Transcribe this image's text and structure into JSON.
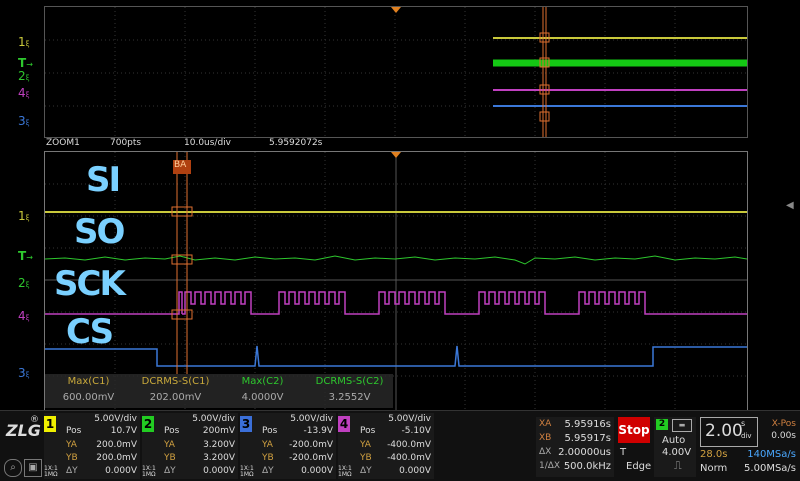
{
  "overview": {
    "channels": [
      {
        "label": "1",
        "sub": "ξ",
        "color": "#c9c93b"
      },
      {
        "label": "T",
        "sub": "",
        "color": "#2ec82e"
      },
      {
        "label": "2",
        "sub": "ξ",
        "color": "#2ec82e"
      },
      {
        "label": "4",
        "sub": "ξ",
        "color": "#c040c0"
      },
      {
        "label": "3",
        "sub": "ξ",
        "color": "#3b78d8"
      }
    ]
  },
  "zoombar": {
    "name": "ZOOM1",
    "pts": "700pts",
    "timebase": "10.0us/div",
    "time": "5.9592072s"
  },
  "zoom": {
    "cursor_tag": "BA",
    "annotations": [
      "SI",
      "SO",
      "SCK",
      "CS"
    ],
    "channels": [
      {
        "label": "1",
        "sub": "ξ",
        "color": "#c9c93b"
      },
      {
        "label": "T",
        "sub": "",
        "color": "#2ec82e"
      },
      {
        "label": "2",
        "sub": "ξ",
        "color": "#2ec82e"
      },
      {
        "label": "4",
        "sub": "ξ",
        "color": "#c040c0"
      },
      {
        "label": "3",
        "sub": "ξ",
        "color": "#3b78d8"
      }
    ]
  },
  "measurements": [
    {
      "name": "Max(C1)",
      "value": "600.00mV",
      "color": "#c9a93b"
    },
    {
      "name": "DCRMS-S(C1)",
      "value": "202.00mV",
      "color": "#c9a93b"
    },
    {
      "name": "Max(C2)",
      "value": "4.0000V",
      "color": "#2ec82e"
    },
    {
      "name": "DCRMS-S(C2)",
      "value": "3.2552V",
      "color": "#2ec82e"
    }
  ],
  "channels_panel": [
    {
      "num": "1",
      "color": "#f0f000",
      "vdiv": "5.00V/div",
      "pos": "10.7V",
      "ya": "200.0mV",
      "yb": "200.0mV",
      "dy": "0.000V",
      "coupling": "1X:1",
      "imp": "1MΩ"
    },
    {
      "num": "2",
      "color": "#22cc22",
      "vdiv": "5.00V/div",
      "pos": "200mV",
      "ya": "3.200V",
      "yb": "3.200V",
      "dy": "0.000V",
      "coupling": "1X:1",
      "imp": "1MΩ"
    },
    {
      "num": "3",
      "color": "#3b6fd8",
      "vdiv": "5.00V/div",
      "pos": "-13.9V",
      "ya": "-200.0mV",
      "yb": "-200.0mV",
      "dy": "0.000V",
      "coupling": "1X:1",
      "imp": "1MΩ"
    },
    {
      "num": "4",
      "color": "#c040c0",
      "vdiv": "5.00V/div",
      "pos": "-5.10V",
      "ya": "-400.0mV",
      "yb": "-400.0mV",
      "dy": "0.000V",
      "coupling": "1X:1",
      "imp": "1MΩ"
    }
  ],
  "labels": {
    "pos": "Pos",
    "ya": "YA",
    "yb": "YB",
    "dy": "ΔY"
  },
  "cursors": {
    "xa_label": "XA",
    "xa": "5.95916s",
    "xb_label": "XB",
    "xb": "5.95917s",
    "dx_label": "ΔX",
    "dx": "2.00000us",
    "inv_label": "1/ΔX",
    "inv": "500.0kHz"
  },
  "trigger": {
    "stop": "Stop",
    "source": "2",
    "mode": "Auto",
    "type_label": "T",
    "level": "4.00V",
    "edge": "Edge"
  },
  "timebase": {
    "value": "2.00",
    "unit_top": "s",
    "unit_bottom": "div",
    "xpos_label": "X-Pos",
    "xpos": "0.00s",
    "record": "28.0s",
    "rate": "140MSa/s",
    "acq_mode": "Norm",
    "acq_rate": "5.00MSa/s"
  },
  "brand": "ZLG"
}
